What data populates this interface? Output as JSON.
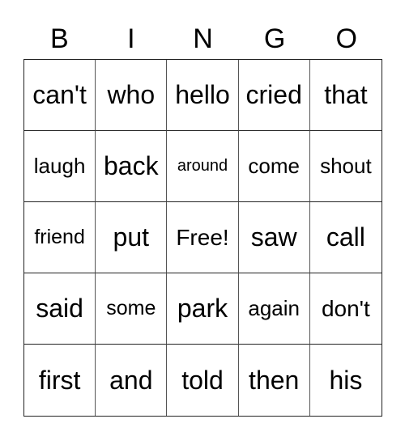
{
  "header": [
    "B",
    "I",
    "N",
    "G",
    "O"
  ],
  "cells": [
    [
      "can't",
      "who",
      "hello",
      "cried",
      "that"
    ],
    [
      "laugh",
      "back",
      "around",
      "come",
      "shout"
    ],
    [
      "friend",
      "put",
      "Free!",
      "saw",
      "call"
    ],
    [
      "said",
      "some",
      "park",
      "again",
      "don't"
    ],
    [
      "first",
      "and",
      "told",
      "then",
      "his"
    ]
  ]
}
